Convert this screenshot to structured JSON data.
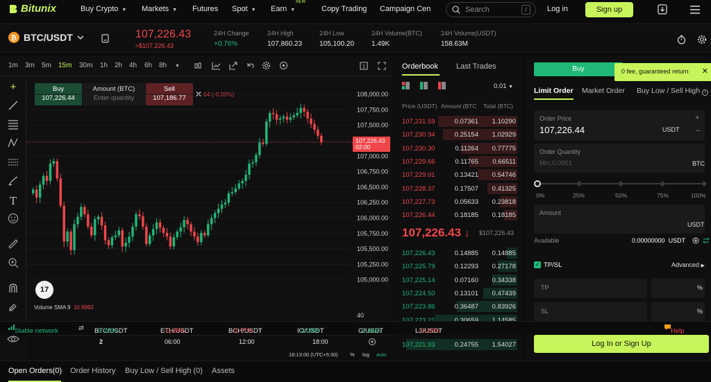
{
  "nav": {
    "logo": "Bitunix",
    "items": [
      "Buy Crypto",
      "Markets",
      "Futures",
      "Spot",
      "Earn",
      "Copy Trading",
      "Campaign Cen"
    ],
    "new_badge": "NEW",
    "search_placeholder": "Search",
    "search_shortcut": "/",
    "login": "Log in",
    "signup": "Sign up"
  },
  "ticker": {
    "pair": "BTC/USDT",
    "price": "107,226.43",
    "price_sub": "≈$107,226.43",
    "stats": [
      {
        "label": "24H Change",
        "value": "+0.76%"
      },
      {
        "label": "24H High",
        "value": "107,860.23"
      },
      {
        "label": "24H Low",
        "value": "105,100.20"
      },
      {
        "label": "24H Volume(BTC)",
        "value": "1.49K"
      },
      {
        "label": "24H Volume(USDT)",
        "value": "158.63M"
      }
    ]
  },
  "chart": {
    "timeframes": [
      "1m",
      "3m",
      "5m",
      "15m",
      "30m",
      "1h",
      "2h",
      "4h",
      "6h",
      "8h"
    ],
    "active_timeframe": "15m",
    "buy_label": "Buy",
    "buy_price": "107,226.44",
    "amount_label": "Amount (BTC)",
    "amount_placeholder": "Enter quantity",
    "sell_label": "Sell",
    "sell_price": "107,186.77",
    "change_tag": "64 (-0.09%)",
    "last_price_tag": "107,226.43",
    "countdown_tag": "02:00",
    "volume_label": "Volume SMA 9",
    "volume_value": "10.9992",
    "volume_axis": "40",
    "time_labels": [
      "2",
      "06:00",
      "12:00",
      "18:00"
    ],
    "clock": "18:13:00 (UTC+5:30)",
    "pct": "%",
    "log": "log",
    "auto": "auto",
    "tv_logo": "17",
    "colors": {
      "up": "#1fb877",
      "down": "#f0464a"
    }
  },
  "chart_data": {
    "type": "candlestick",
    "title": "BTC/USDT",
    "interval": "15m",
    "y_ticks": [
      105000,
      105250,
      105500,
      105750,
      106000,
      106250,
      106500,
      106750,
      107000,
      107250,
      107500,
      107750,
      108000
    ],
    "ylim": [
      104850,
      108080
    ],
    "last_price": 107226.43,
    "x_tick_labels": [
      "2",
      "06:00",
      "12:00",
      "18:00"
    ],
    "closes": [
      106460,
      106330,
      106540,
      106680,
      106600,
      106880,
      106920,
      106640,
      106200,
      105620,
      105780,
      105480,
      105900,
      106020,
      106180,
      106060,
      105860,
      105720,
      105980,
      106020,
      105880,
      105640,
      105560,
      105690,
      105720,
      105800,
      105540,
      105600,
      105700,
      105860,
      106060,
      106030,
      105860,
      105580,
      105720,
      105820,
      105930,
      105840,
      105760,
      105700,
      105540,
      105690,
      105780,
      105850,
      105970,
      105900,
      105780,
      105700,
      105610,
      105760,
      105720,
      105900,
      106000,
      106080,
      106150,
      106220,
      106250,
      106400,
      106420,
      106480,
      106560,
      106600,
      106700,
      106880,
      106900,
      107020,
      107220,
      107200,
      107560,
      107700,
      107680,
      107590,
      107610,
      107640,
      107590,
      107630,
      107660,
      107700,
      107780,
      107720,
      107610,
      107520,
      107430,
      107330,
      107226
    ]
  },
  "orderbook": {
    "tabs": [
      "Orderbook",
      "Last Trades"
    ],
    "precision": "0.01",
    "headers": [
      "Price (USDT)",
      "Amount (BTC",
      "Total (BTC)"
    ],
    "asks": [
      [
        "107,231.59",
        "0.07361",
        "1.10290"
      ],
      [
        "107,230.94",
        "0.25154",
        "1.02929"
      ],
      [
        "107,230.30",
        "0.11264",
        "0.77775"
      ],
      [
        "107,229.66",
        "0.11765",
        "0.66511"
      ],
      [
        "107,229.01",
        "0.13421",
        "0.54746"
      ],
      [
        "107,228.37",
        "0.17507",
        "0.41325"
      ],
      [
        "107,227.73",
        "0.05633",
        "0.23818"
      ],
      [
        "107,226.44",
        "0.18185",
        "0.18185"
      ]
    ],
    "mid_price": "107,226.43",
    "mid_arrow": "↓",
    "mid_sub": "$107,226.43",
    "bids": [
      [
        "107,226.43",
        "0.14885",
        "0.14885"
      ],
      [
        "107,225.79",
        "0.12293",
        "0.27178"
      ],
      [
        "107,225.14",
        "0.07160",
        "0.34338"
      ],
      [
        "107,224.50",
        "0.13101",
        "0.47439"
      ],
      [
        "107,223.86",
        "0.36487",
        "0.83926"
      ],
      [
        "107,223.21",
        "0.30659",
        "1.14585"
      ],
      [
        "107,221.93",
        "0.24755",
        "1.54027"
      ]
    ]
  },
  "orderform": {
    "side_buy": "Buy",
    "promo": "0 fee, guaranteed return",
    "tabs": [
      "Limit Order",
      "Market Order",
      "Buy Low / Sell High"
    ],
    "order_price_label": "Order Price",
    "order_price": "107,226.44",
    "order_price_unit": "USDT",
    "qty_label": "Order Quantity",
    "qty_placeholder": "Min.0.0001",
    "qty_unit": "BTC",
    "slider_marks": [
      "0%",
      "25%",
      "50%",
      "75%",
      "100%"
    ],
    "amount_label": "Amount",
    "amount_unit": "USDT",
    "available_label": "Available",
    "available_value": "0.00000000",
    "available_unit": "USDT",
    "tpsl_label": "TP/SL",
    "advanced": "Advanced",
    "tp": "TP",
    "sl": "SL",
    "pct": "%",
    "help": "Help",
    "login_btn": "Log In or Sign Up"
  },
  "market_strip": {
    "network": "Stable network",
    "pairs": [
      {
        "name": "BTC/USDT",
        "change": "0.76%",
        "dir": "up"
      },
      {
        "name": "ETH/USDT",
        "change": "-0.28%",
        "dir": "down"
      },
      {
        "name": "BCH/USDT",
        "change": "-2.77%",
        "dir": "down"
      },
      {
        "name": "IO/USDT",
        "change": "2.03%",
        "dir": "up"
      },
      {
        "name": "G/USDT",
        "change": "1.64%",
        "dir": "up"
      },
      {
        "name": "L3/USDT",
        "change": "-0.22%",
        "dir": "down"
      }
    ]
  },
  "bottom_tabs": [
    "Open Orders(0)",
    "Order History",
    "Buy Low / Sell High (0)",
    "Assets"
  ]
}
